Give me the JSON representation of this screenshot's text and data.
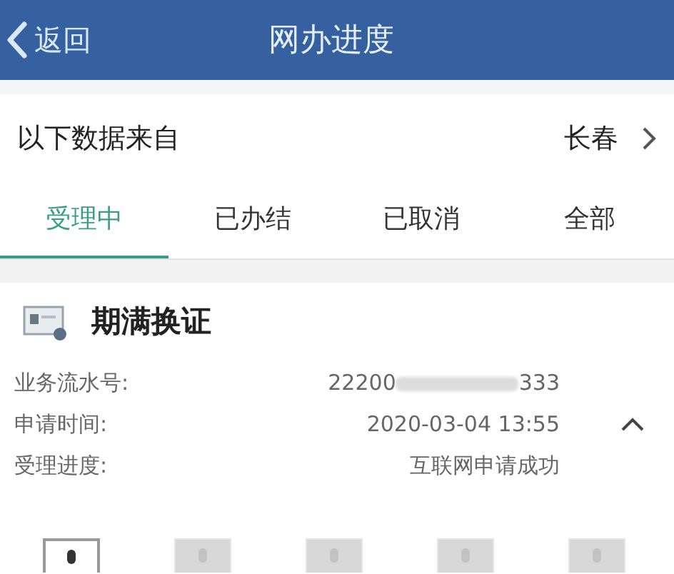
{
  "header": {
    "back": "返回",
    "title": "网办进度"
  },
  "source": {
    "label": "以下数据来自",
    "city": "长春"
  },
  "tabs": [
    {
      "label": "受理中",
      "selected": true
    },
    {
      "label": "已办结",
      "selected": false
    },
    {
      "label": "已取消",
      "selected": false
    },
    {
      "label": "全部",
      "selected": false
    }
  ],
  "card": {
    "title": "期满换证",
    "expanded": true,
    "rows": [
      {
        "label": "业务流水号:",
        "kind": "masked",
        "value_start": "22200",
        "value_end": "333"
      },
      {
        "label": "申请时间:",
        "kind": "text",
        "value": "2020-03-04 13:55"
      },
      {
        "label": "受理进度:",
        "kind": "text",
        "value": "互联网申请成功"
      }
    ]
  },
  "steps": [
    {
      "active": true
    },
    {
      "active": false
    },
    {
      "active": false
    },
    {
      "active": false
    },
    {
      "active": false
    }
  ]
}
